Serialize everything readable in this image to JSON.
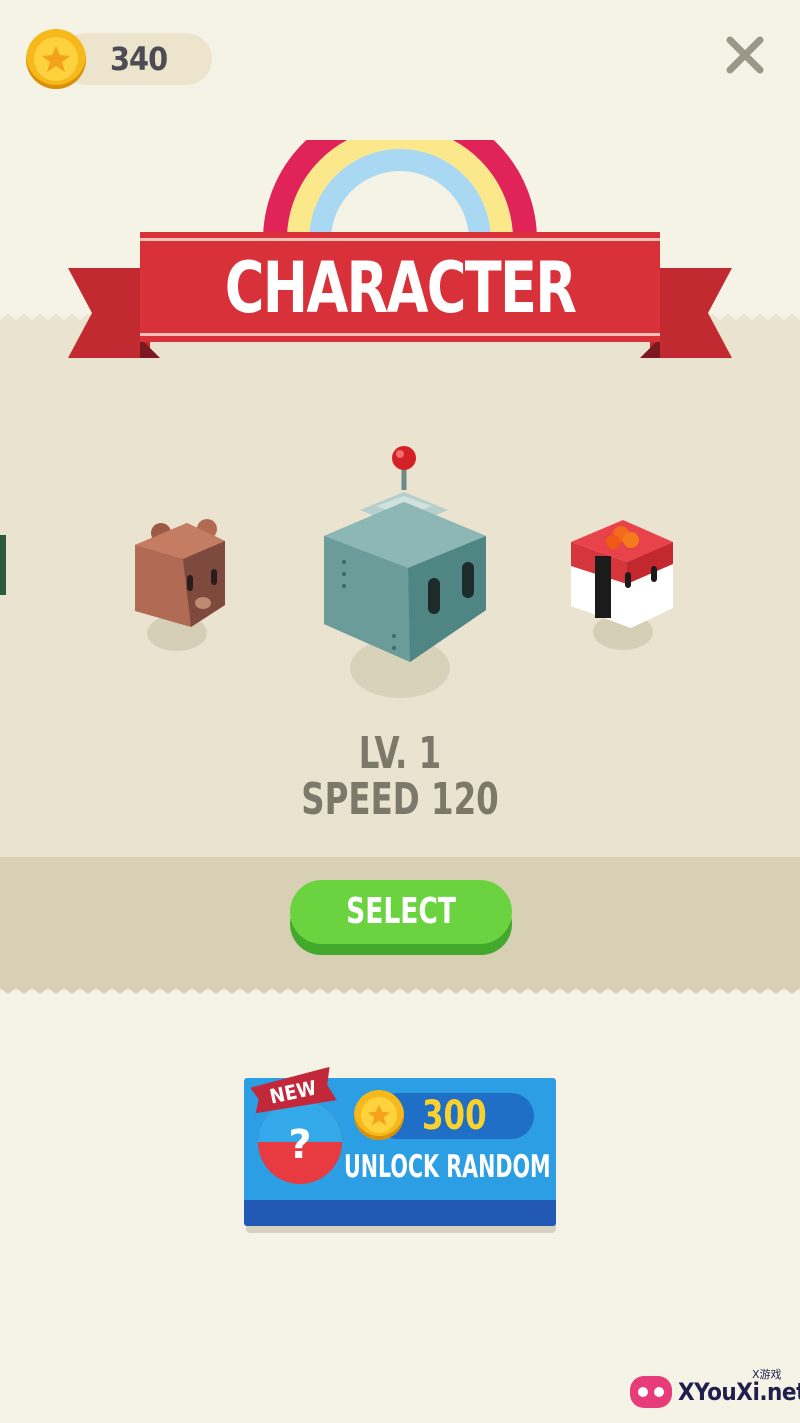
{
  "hud": {
    "coins": "340"
  },
  "screen": {
    "title": "CHARACTER"
  },
  "carousel": {
    "characters": [
      {
        "icon": "green-block-character-icon",
        "position": "far-left"
      },
      {
        "icon": "bear-character-icon",
        "position": "left"
      },
      {
        "icon": "robot-character-icon",
        "position": "selected"
      },
      {
        "icon": "sushi-character-icon",
        "position": "right"
      }
    ]
  },
  "stats": {
    "level": "LV. 1",
    "speed": "SPEED 120"
  },
  "select_label": "SELECT",
  "unlock": {
    "badge": "NEW",
    "cost": "300",
    "label": "UNLOCK RANDOM"
  },
  "watermark": {
    "text": "XYouXi.net",
    "small": "X游戏"
  },
  "colors": {
    "background": "#f5f2e6",
    "band": "#e9e3cf",
    "banner_red": "#d8313a",
    "select_green": "#6bd340",
    "unlock_blue": "#2c9ee3",
    "coin_gold": "#fbd12d"
  }
}
